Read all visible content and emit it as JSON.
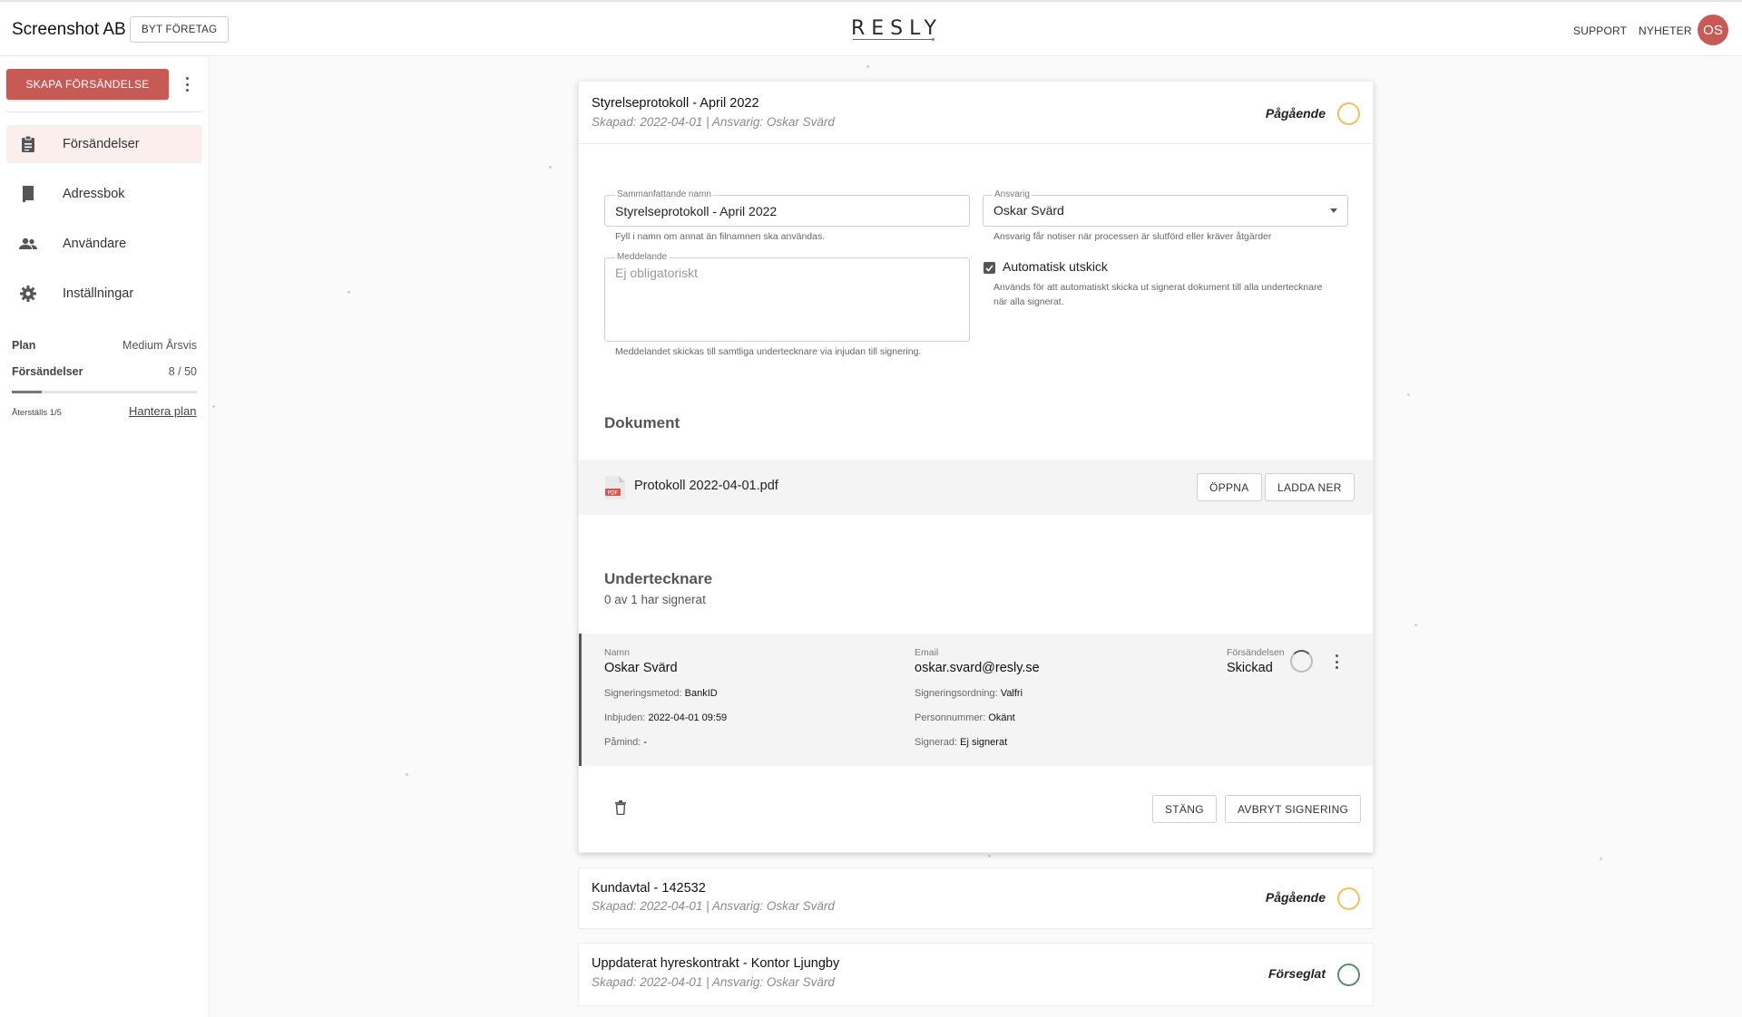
{
  "header": {
    "company": "Screenshot AB",
    "switch_company": "BYT FÖRETAG",
    "logo": "RESLY",
    "support": "SUPPORT",
    "news": "NYHETER",
    "avatar_initials": "OS"
  },
  "sidebar": {
    "create_label": "SKAPA FÖRSÄNDELSE",
    "items": [
      {
        "label": "Försändelser",
        "icon": "clipboard-icon",
        "active": true
      },
      {
        "label": "Adressbok",
        "icon": "book-icon",
        "active": false
      },
      {
        "label": "Användare",
        "icon": "users-icon",
        "active": false
      },
      {
        "label": "Inställningar",
        "icon": "gear-icon",
        "active": false
      }
    ],
    "plan": {
      "plan_label": "Plan",
      "plan_value": "Medium Årsvis",
      "sendings_label": "Försändelser",
      "sendings_value": "8 / 50",
      "usage_fraction": 0.16,
      "reset_text": "Återställs 1/5",
      "manage_label": "Hantera plan"
    }
  },
  "expanded_card": {
    "title": "Styrelseprotokoll - April 2022",
    "subtitle": "Skapad: 2022-04-01 | Ansvarig: Oskar Svärd",
    "status": "Pågående",
    "status_color": "#f0c060",
    "form": {
      "name_label": "Sammanfattande namn",
      "name_value": "Styrelseprotokoll - April 2022",
      "name_helper": "Fyll i namn om annat än filnamnen ska användas.",
      "responsible_label": "Ansvarig",
      "responsible_value": "Oskar Svärd",
      "responsible_helper": "Ansvarig får notiser när processen är slutförd eller kräver åtgärder",
      "message_label": "Meddelande",
      "message_placeholder": "Ej obligatoriskt",
      "message_helper": "Meddelandet skickas till samtliga undertecknare via injudan till signering.",
      "auto_label": "Automatisk utskick",
      "auto_checked": true,
      "auto_helper_1": "Används för att automatiskt skicka ut signerat dokument till alla undertecknare",
      "auto_helper_2": "när alla signerat."
    },
    "documents": {
      "title": "Dokument",
      "file_name": "Protokoll 2022-04-01.pdf",
      "pdf_badge": "PDF",
      "open_label": "ÖPPNA",
      "download_label": "LADDA NER"
    },
    "signers": {
      "title": "Undertecknare",
      "summary": "0 av 1 har signerat",
      "row": {
        "name_label": "Namn",
        "name": "Oskar Svärd",
        "email_label": "Email",
        "email": "oskar.svard@resly.se",
        "status_label": "Försändelsen",
        "status": "Skickad",
        "method_label": "Signeringsmetod:",
        "method": "BankID",
        "order_label": "Signeringsordning:",
        "order": "Valfri",
        "invited_label": "Inbjuden:",
        "invited": "2022-04-01 09:59",
        "ssn_label": "Personnummer:",
        "ssn": "Okänt",
        "reminded_label": "Påmind:",
        "reminded": "-",
        "signed_label": "Signerad:",
        "signed": "Ej signerat"
      }
    },
    "close_label": "STÄNG",
    "cancel_label": "AVBRYT SIGNERING"
  },
  "other_cards": [
    {
      "title": "Kundavtal - 142532",
      "subtitle": "Skapad: 2022-04-01 | Ansvarig: Oskar Svärd",
      "status": "Pågående",
      "status_color": "#f0c060"
    },
    {
      "title": "Uppdaterat hyreskontrakt - Kontor Ljungby",
      "subtitle": "Skapad: 2022-04-01 | Ansvarig: Oskar Svärd",
      "status": "Förseglat",
      "status_color": "#5b8f6a"
    }
  ]
}
